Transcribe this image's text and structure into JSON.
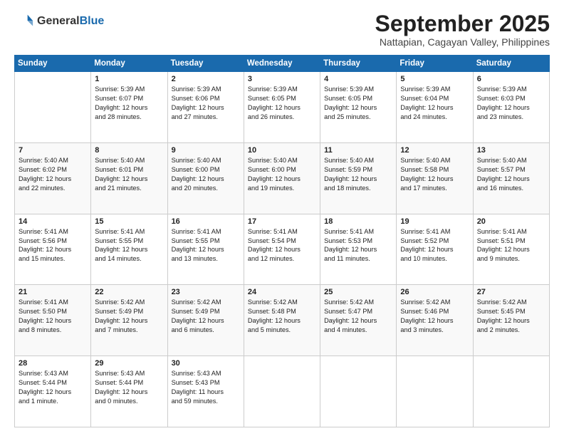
{
  "header": {
    "logo_general": "General",
    "logo_blue": "Blue",
    "month_title": "September 2025",
    "location": "Nattapian, Cagayan Valley, Philippines"
  },
  "days_of_week": [
    "Sunday",
    "Monday",
    "Tuesday",
    "Wednesday",
    "Thursday",
    "Friday",
    "Saturday"
  ],
  "weeks": [
    [
      {
        "day": "",
        "content": ""
      },
      {
        "day": "1",
        "content": "Sunrise: 5:39 AM\nSunset: 6:07 PM\nDaylight: 12 hours\nand 28 minutes."
      },
      {
        "day": "2",
        "content": "Sunrise: 5:39 AM\nSunset: 6:06 PM\nDaylight: 12 hours\nand 27 minutes."
      },
      {
        "day": "3",
        "content": "Sunrise: 5:39 AM\nSunset: 6:05 PM\nDaylight: 12 hours\nand 26 minutes."
      },
      {
        "day": "4",
        "content": "Sunrise: 5:39 AM\nSunset: 6:05 PM\nDaylight: 12 hours\nand 25 minutes."
      },
      {
        "day": "5",
        "content": "Sunrise: 5:39 AM\nSunset: 6:04 PM\nDaylight: 12 hours\nand 24 minutes."
      },
      {
        "day": "6",
        "content": "Sunrise: 5:39 AM\nSunset: 6:03 PM\nDaylight: 12 hours\nand 23 minutes."
      }
    ],
    [
      {
        "day": "7",
        "content": "Sunrise: 5:40 AM\nSunset: 6:02 PM\nDaylight: 12 hours\nand 22 minutes."
      },
      {
        "day": "8",
        "content": "Sunrise: 5:40 AM\nSunset: 6:01 PM\nDaylight: 12 hours\nand 21 minutes."
      },
      {
        "day": "9",
        "content": "Sunrise: 5:40 AM\nSunset: 6:00 PM\nDaylight: 12 hours\nand 20 minutes."
      },
      {
        "day": "10",
        "content": "Sunrise: 5:40 AM\nSunset: 6:00 PM\nDaylight: 12 hours\nand 19 minutes."
      },
      {
        "day": "11",
        "content": "Sunrise: 5:40 AM\nSunset: 5:59 PM\nDaylight: 12 hours\nand 18 minutes."
      },
      {
        "day": "12",
        "content": "Sunrise: 5:40 AM\nSunset: 5:58 PM\nDaylight: 12 hours\nand 17 minutes."
      },
      {
        "day": "13",
        "content": "Sunrise: 5:40 AM\nSunset: 5:57 PM\nDaylight: 12 hours\nand 16 minutes."
      }
    ],
    [
      {
        "day": "14",
        "content": "Sunrise: 5:41 AM\nSunset: 5:56 PM\nDaylight: 12 hours\nand 15 minutes."
      },
      {
        "day": "15",
        "content": "Sunrise: 5:41 AM\nSunset: 5:55 PM\nDaylight: 12 hours\nand 14 minutes."
      },
      {
        "day": "16",
        "content": "Sunrise: 5:41 AM\nSunset: 5:55 PM\nDaylight: 12 hours\nand 13 minutes."
      },
      {
        "day": "17",
        "content": "Sunrise: 5:41 AM\nSunset: 5:54 PM\nDaylight: 12 hours\nand 12 minutes."
      },
      {
        "day": "18",
        "content": "Sunrise: 5:41 AM\nSunset: 5:53 PM\nDaylight: 12 hours\nand 11 minutes."
      },
      {
        "day": "19",
        "content": "Sunrise: 5:41 AM\nSunset: 5:52 PM\nDaylight: 12 hours\nand 10 minutes."
      },
      {
        "day": "20",
        "content": "Sunrise: 5:41 AM\nSunset: 5:51 PM\nDaylight: 12 hours\nand 9 minutes."
      }
    ],
    [
      {
        "day": "21",
        "content": "Sunrise: 5:41 AM\nSunset: 5:50 PM\nDaylight: 12 hours\nand 8 minutes."
      },
      {
        "day": "22",
        "content": "Sunrise: 5:42 AM\nSunset: 5:49 PM\nDaylight: 12 hours\nand 7 minutes."
      },
      {
        "day": "23",
        "content": "Sunrise: 5:42 AM\nSunset: 5:49 PM\nDaylight: 12 hours\nand 6 minutes."
      },
      {
        "day": "24",
        "content": "Sunrise: 5:42 AM\nSunset: 5:48 PM\nDaylight: 12 hours\nand 5 minutes."
      },
      {
        "day": "25",
        "content": "Sunrise: 5:42 AM\nSunset: 5:47 PM\nDaylight: 12 hours\nand 4 minutes."
      },
      {
        "day": "26",
        "content": "Sunrise: 5:42 AM\nSunset: 5:46 PM\nDaylight: 12 hours\nand 3 minutes."
      },
      {
        "day": "27",
        "content": "Sunrise: 5:42 AM\nSunset: 5:45 PM\nDaylight: 12 hours\nand 2 minutes."
      }
    ],
    [
      {
        "day": "28",
        "content": "Sunrise: 5:43 AM\nSunset: 5:44 PM\nDaylight: 12 hours\nand 1 minute."
      },
      {
        "day": "29",
        "content": "Sunrise: 5:43 AM\nSunset: 5:44 PM\nDaylight: 12 hours\nand 0 minutes."
      },
      {
        "day": "30",
        "content": "Sunrise: 5:43 AM\nSunset: 5:43 PM\nDaylight: 11 hours\nand 59 minutes."
      },
      {
        "day": "",
        "content": ""
      },
      {
        "day": "",
        "content": ""
      },
      {
        "day": "",
        "content": ""
      },
      {
        "day": "",
        "content": ""
      }
    ]
  ]
}
